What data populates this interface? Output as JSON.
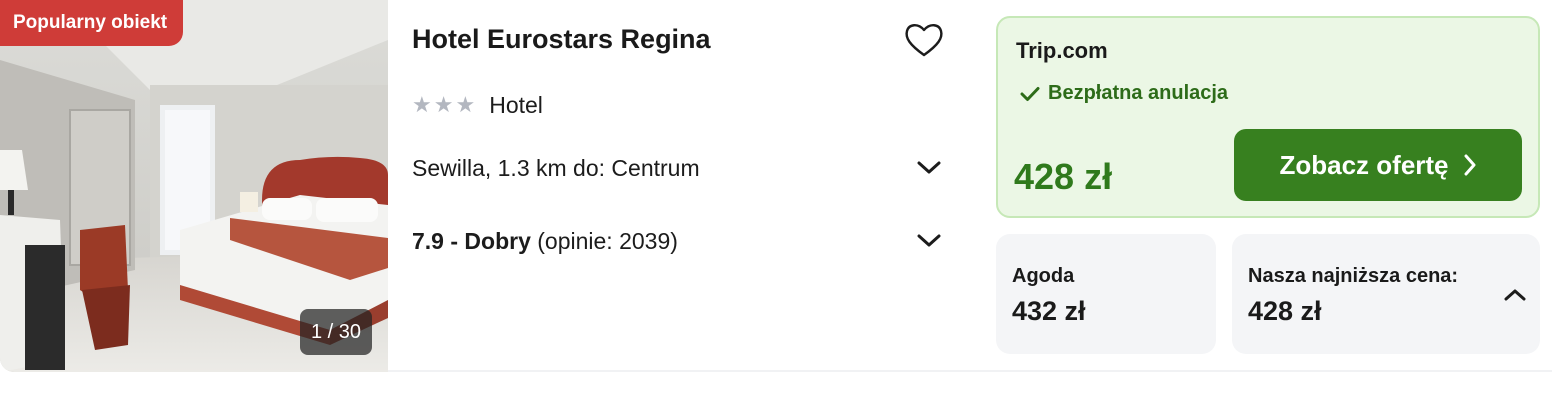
{
  "photo": {
    "badge": "Popularny obiekt",
    "counter": "1 / 30"
  },
  "hotel": {
    "name": "Hotel Eurostars Regina",
    "stars": 3,
    "type": "Hotel",
    "location": "Sewilla, 1.3 km do: Centrum",
    "rating_score": "7.9 - Dobry",
    "rating_reviews": "(opinie: 2039)"
  },
  "offer": {
    "provider": "Trip.com",
    "cancellation": "Bezpłatna anulacja",
    "price": "428 zł",
    "cta_label": "Zobacz ofertę"
  },
  "other_prices": [
    {
      "label": "Agoda",
      "price": "432 zł"
    },
    {
      "label": "Nasza najniższa cena:",
      "price": "428 zł"
    }
  ],
  "icons": {
    "favorite": "heart-outline-icon",
    "expand": "chevron-down-icon",
    "collapse": "chevron-up-icon",
    "check": "check-icon",
    "cta_arrow": "chevron-right-icon"
  },
  "colors": {
    "badge": "#cf3c38",
    "offer_bg": "#ebf7e5",
    "price_green": "#2f7a1c",
    "cta_green": "#37801f"
  }
}
